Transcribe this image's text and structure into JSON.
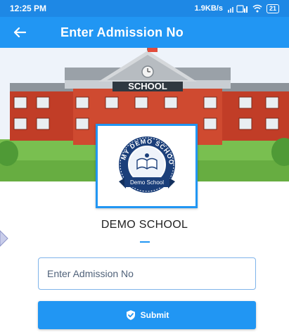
{
  "status_bar": {
    "time": "12:25 PM",
    "network_speed": "1.9KB/s",
    "battery": "21"
  },
  "app_bar": {
    "title": "Enter Admission No",
    "back_icon": "arrow-left-icon"
  },
  "banner": {
    "sign_text": "SCHOOL",
    "colors": {
      "sky": "#eef3fa",
      "brick": "#c13d27",
      "roof": "#8d949b",
      "grass": "#6ab344"
    }
  },
  "logo": {
    "ring_text": "MY DEMO SCHOOL",
    "ribbon_text": "Demo School"
  },
  "school": {
    "name": "DEMO SCHOOL"
  },
  "form": {
    "admission_placeholder": "Enter Admission No",
    "admission_value": "",
    "submit_label": "Submit",
    "submit_icon": "shield-check-icon"
  },
  "colors": {
    "primary": "#2196f3",
    "status_bar": "#1e88e5"
  }
}
